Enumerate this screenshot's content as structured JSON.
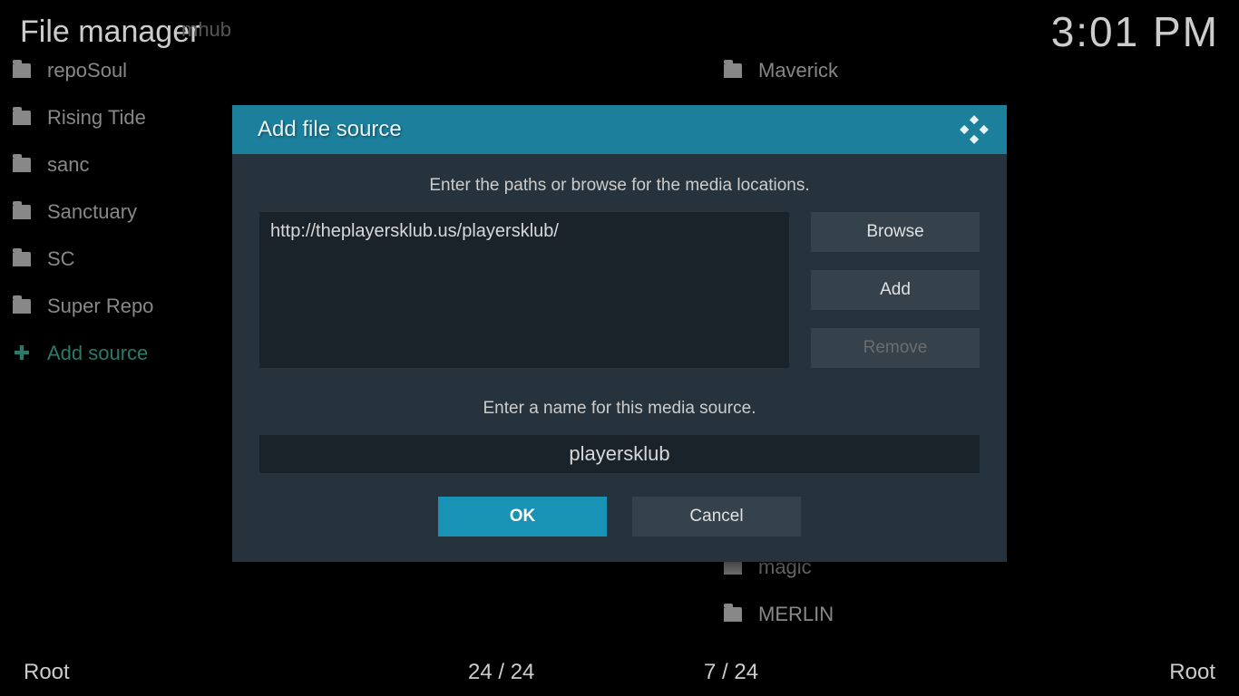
{
  "header": {
    "title": "File manager",
    "clock": "3:01 PM"
  },
  "left_items": [
    {
      "label": "repoSoul"
    },
    {
      "label": "Rising Tide"
    },
    {
      "label": "sanc"
    },
    {
      "label": "Sanctuary"
    },
    {
      "label": "SC"
    },
    {
      "label": "Super Repo"
    }
  ],
  "left_partial": "mhub",
  "add_source_label": "Add source",
  "right_items": [
    {
      "label": "Maverick"
    },
    {
      "label": "magic"
    },
    {
      "label": "MERLIN"
    }
  ],
  "footer": {
    "left_root": "Root",
    "left_count": "24 / 24",
    "right_count": "7 / 24",
    "right_root": "Root"
  },
  "dialog": {
    "title": "Add file source",
    "path_instruction": "Enter the paths or browse for the media locations.",
    "path_value": "http://theplayersklub.us/playersklub/",
    "browse_label": "Browse",
    "add_label": "Add",
    "remove_label": "Remove",
    "name_instruction": "Enter a name for this media source.",
    "name_value": "playersklub",
    "ok_label": "OK",
    "cancel_label": "Cancel"
  }
}
